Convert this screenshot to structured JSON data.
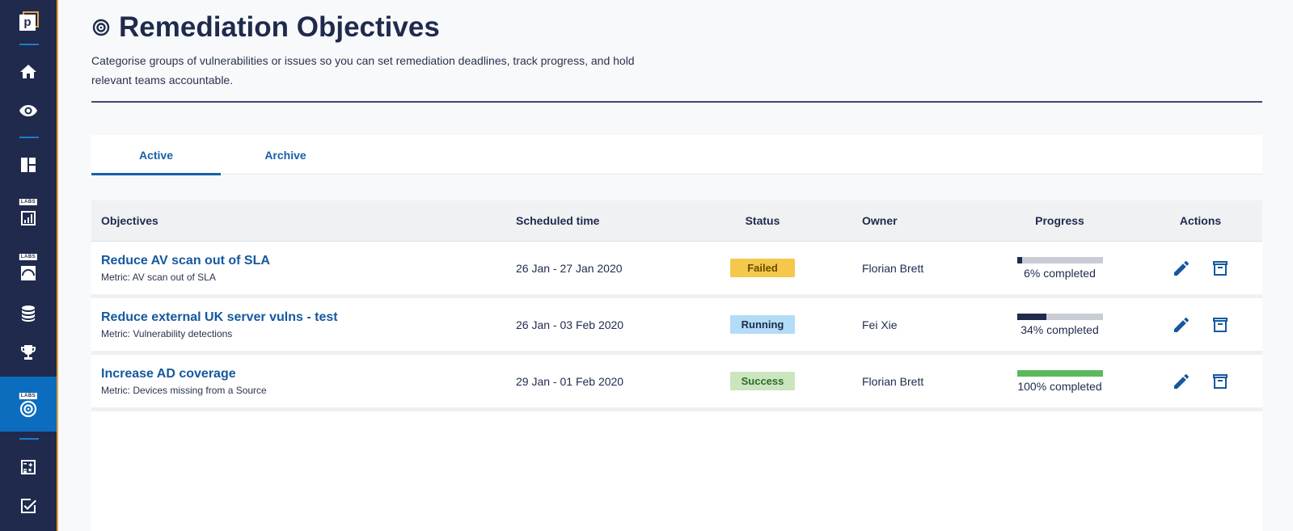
{
  "page": {
    "title": "Remediation Objectives",
    "description": "Categorise groups of vulnerabilities or issues so you can set remediation deadlines, track progress, and hold relevant teams accountable."
  },
  "sidebar": {
    "logo_letter": "p",
    "labs_label": "LABS",
    "items": [
      {
        "icon": "home-icon"
      },
      {
        "icon": "eye-icon"
      },
      {
        "icon": "dashboard-icon"
      },
      {
        "icon": "report-chart-icon",
        "labs": true
      },
      {
        "icon": "gauge-icon",
        "labs": true
      },
      {
        "icon": "database-icon"
      },
      {
        "icon": "trophy-icon"
      },
      {
        "icon": "target-icon",
        "labs": true,
        "active": true
      },
      {
        "icon": "calculator-icon"
      },
      {
        "icon": "checkbox-icon"
      }
    ]
  },
  "tabs": [
    {
      "label": "Active",
      "active": true
    },
    {
      "label": "Archive",
      "active": false
    }
  ],
  "table": {
    "headers": {
      "objectives": "Objectives",
      "scheduled": "Scheduled time",
      "status": "Status",
      "owner": "Owner",
      "progress": "Progress",
      "actions": "Actions"
    },
    "rows": [
      {
        "title": "Reduce AV scan out of SLA",
        "metric": "Metric: AV scan out of SLA",
        "scheduled": "26 Jan - 27 Jan 2020",
        "status": "Failed",
        "owner": "Florian Brett",
        "progress": 0.06,
        "progress_label": "6% completed"
      },
      {
        "title": "Reduce external UK server vulns - test",
        "metric": "Metric: Vulnerability detections",
        "scheduled": "26 Jan - 03 Feb 2020",
        "status": "Running",
        "owner": "Fei Xie",
        "progress": 0.34,
        "progress_label": "34% completed"
      },
      {
        "title": "Increase AD coverage",
        "metric": "Metric: Devices missing from a Source",
        "scheduled": "29 Jan - 01 Feb 2020",
        "status": "Success",
        "owner": "Florian Brett",
        "progress": 1.0,
        "progress_label": "100% completed"
      }
    ]
  },
  "colors": {
    "sidebar_bg": "#1f2a4d",
    "accent": "#0c6dbf",
    "link": "#15589e",
    "failed_bg": "#f5c84c",
    "failed_text": "#6b4a00",
    "running_bg": "#b3dcf6",
    "running_text": "#1f2a4d",
    "success_bg": "#cbe5bf",
    "success_text": "#2e6b23",
    "progress_dark": "#1f2a4d",
    "progress_success": "#5cb85c"
  }
}
